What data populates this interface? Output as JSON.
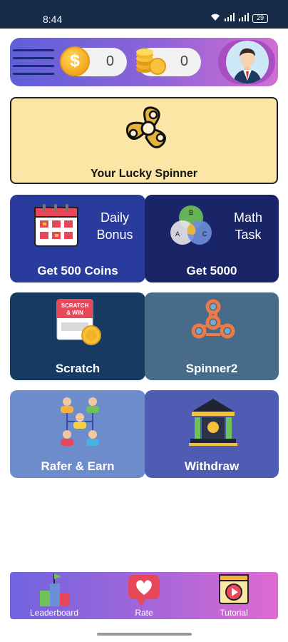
{
  "status_bar": {
    "time": "8:44",
    "battery": "29"
  },
  "top_bar": {
    "coins_value": "0",
    "stack_value": "0",
    "coin_symbol": "$"
  },
  "lucky": {
    "label": "Your Lucky Spinner"
  },
  "tiles": {
    "daily": {
      "caption_1": "Daily",
      "caption_2": "Bonus",
      "label": "Get 500 Coins"
    },
    "math": {
      "caption_1": "Math",
      "caption_2": "Task",
      "label": "Get 5000",
      "venn_b": "B",
      "venn_a": "A",
      "venn_c": "C"
    },
    "scratch": {
      "label": "Scratch",
      "card_text_1": "SCRATCH",
      "card_text_2": "& WIN"
    },
    "spinner2": {
      "label": "Spinner2"
    },
    "refer": {
      "label": "Rafer & Earn"
    },
    "withdraw": {
      "label": "Withdraw"
    }
  },
  "bottom_nav": {
    "leaderboard": "Leaderboard",
    "rate": "Rate",
    "tutorial": "Tutorial"
  }
}
